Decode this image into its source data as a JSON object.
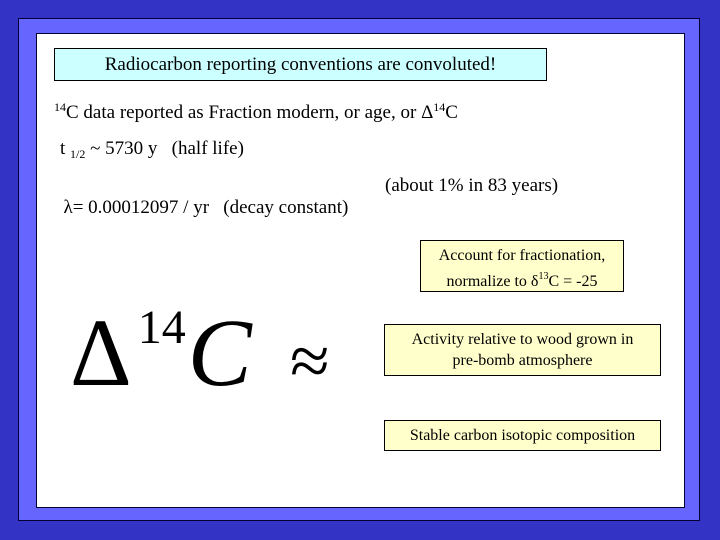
{
  "slide": {
    "title": "Radiocarbon reporting conventions are convoluted!",
    "line1": {
      "sup": "14",
      "text_a": "C data reported as Fraction modern, or age, or ",
      "delta": "Δ",
      "sup2": "14",
      "text_b": "C"
    },
    "line2": {
      "t": "t",
      "sub": "1/2",
      "text": " ~ 5730 y   (half life)"
    },
    "line3": {
      "text": "λ= 0.00012097 / yr   (decay constant)",
      "aside": "(about 1% in 83 years)"
    },
    "formula": {
      "delta": "Δ",
      "sup": "14",
      "c": "C",
      "approx": "≈"
    },
    "notes": [
      {
        "line1": "Account for fractionation,",
        "line2_a": "normalize to ",
        "delta": "δ",
        "sup": "13",
        "line2_b": "C = -25"
      },
      {
        "line1": "Activity relative to wood grown in",
        "line2": "pre-bomb atmosphere"
      },
      {
        "line1": "Stable carbon isotopic composition"
      }
    ],
    "colors": {
      "background": "#3333c6",
      "frame": "#6666ff",
      "title_box": "#ccffff",
      "note_box": "#ffffcc"
    }
  }
}
